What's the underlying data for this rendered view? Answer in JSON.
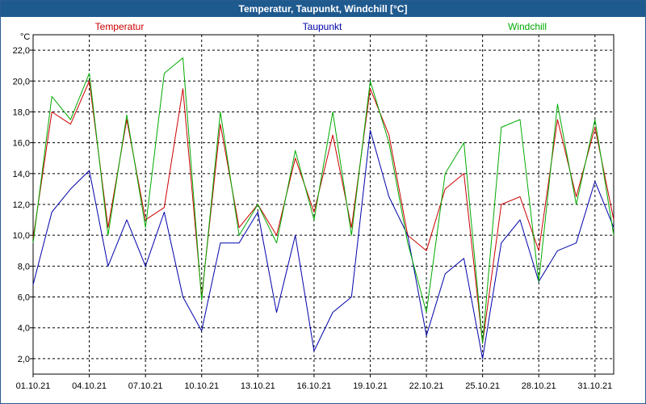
{
  "window": {
    "title": "Temperatur, Taupunkt, Windchill [°C]"
  },
  "chart_data": {
    "type": "line",
    "title": "Temperatur, Taupunkt, Windchill [°C]",
    "ylabel": "°C",
    "xlabel": "",
    "ylim": [
      1.0,
      23.0
    ],
    "xlim": [
      "01.10.21",
      "01.11.21"
    ],
    "grid": true,
    "x_ticks": [
      "01.10.21",
      "04.10.21",
      "07.10.21",
      "10.10.21",
      "13.10.21",
      "16.10.21",
      "19.10.21",
      "22.10.21",
      "25.10.21",
      "28.10.21",
      "31.10.21"
    ],
    "y_ticks": [
      2.0,
      4.0,
      6.0,
      8.0,
      10.0,
      12.0,
      14.0,
      16.0,
      18.0,
      20.0,
      22.0
    ],
    "y_tick_labels": [
      "2,0",
      "4,0",
      "6,0",
      "8,0",
      "10,0",
      "12,0",
      "14,0",
      "16,0",
      "18,0",
      "20,0",
      "22,0"
    ],
    "x": [
      "01.10.21",
      "02.10.21",
      "03.10.21",
      "04.10.21",
      "05.10.21",
      "06.10.21",
      "07.10.21",
      "08.10.21",
      "09.10.21",
      "10.10.21",
      "11.10.21",
      "12.10.21",
      "13.10.21",
      "14.10.21",
      "15.10.21",
      "16.10.21",
      "17.10.21",
      "18.10.21",
      "19.10.21",
      "20.10.21",
      "21.10.21",
      "22.10.21",
      "23.10.21",
      "24.10.21",
      "25.10.21",
      "26.10.21",
      "27.10.21",
      "28.10.21",
      "29.10.21",
      "30.10.21",
      "31.10.21",
      "01.11.21"
    ],
    "series": [
      {
        "name": "Temperatur",
        "color": "#cc0000",
        "values": [
          9.8,
          18.0,
          17.2,
          20.0,
          10.5,
          17.5,
          11.0,
          11.8,
          19.5,
          6.0,
          17.2,
          10.5,
          12.0,
          10.0,
          15.0,
          11.5,
          16.5,
          10.5,
          19.5,
          16.5,
          10.0,
          9.0,
          13.0,
          14.0,
          3.0,
          12.0,
          12.5,
          9.0,
          17.5,
          12.5,
          17.0,
          11.0
        ]
      },
      {
        "name": "Taupunkt",
        "color": "#0000aa",
        "values": [
          6.8,
          11.5,
          13.0,
          14.2,
          8.0,
          11.0,
          8.0,
          11.5,
          6.0,
          3.8,
          9.5,
          9.5,
          11.5,
          5.0,
          10.0,
          2.5,
          5.0,
          6.0,
          16.8,
          12.5,
          10.0,
          3.5,
          7.5,
          8.5,
          2.0,
          9.5,
          11.0,
          7.0,
          9.0,
          9.5,
          13.5,
          10.5
        ]
      },
      {
        "name": "Windchill",
        "color": "#00aa00",
        "values": [
          9.5,
          19.0,
          17.5,
          20.5,
          10.0,
          17.8,
          10.5,
          20.5,
          21.5,
          5.8,
          18.0,
          10.0,
          12.0,
          9.5,
          15.5,
          11.0,
          18.0,
          10.0,
          20.0,
          16.0,
          9.5,
          5.0,
          14.0,
          16.0,
          3.0,
          17.0,
          17.5,
          7.0,
          18.5,
          12.0,
          17.5,
          10.0
        ]
      }
    ]
  }
}
